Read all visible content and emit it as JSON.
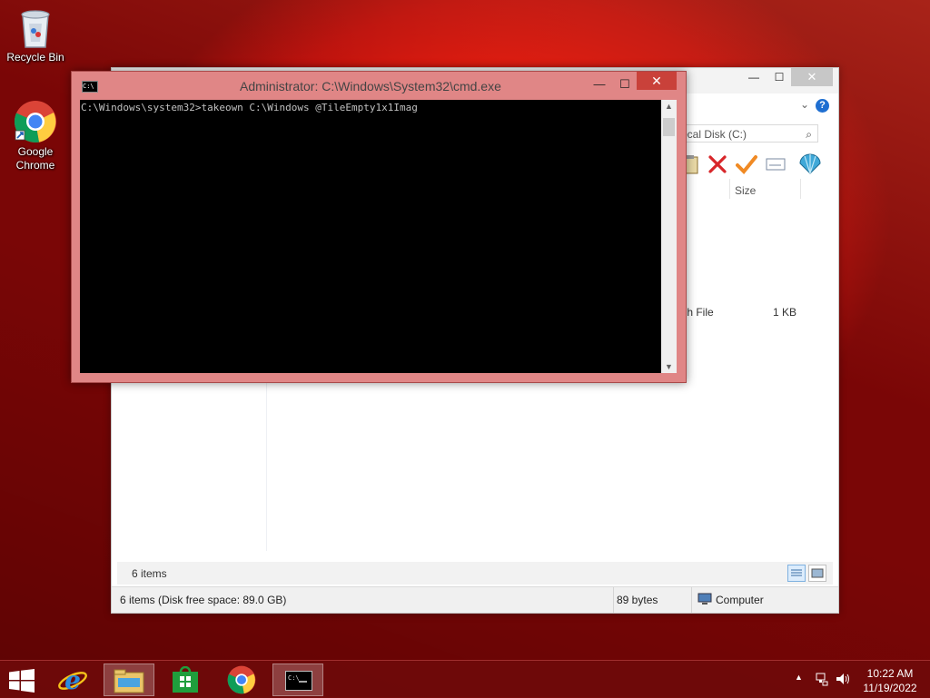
{
  "desktop": {
    "icons": [
      {
        "label": "Recycle Bin",
        "icon": "recycle-bin-icon"
      },
      {
        "label": "Google Chrome",
        "icon": "chrome-icon"
      }
    ]
  },
  "explorer": {
    "search_placeholder": "ocal Disk (C:)",
    "column_size": "Size",
    "rows": [
      {
        "type": "tch File",
        "size": "1 KB"
      }
    ],
    "bottom_count": "6 items",
    "status": {
      "items_free": "6 items (Disk free space: 89.0 GB)",
      "size": "89 bytes",
      "location": "Computer"
    }
  },
  "cmd": {
    "title": "Administrator: C:\\Windows\\System32\\cmd.exe",
    "console_line": "C:\\Windows\\system32>takeown C:\\Windows @TileEmpty1x1Imag",
    "icon_text": "C:\\",
    "close_glyph": "✕",
    "min_glyph": "—",
    "max_glyph": "☐"
  },
  "taskbar": {
    "items": [
      "start",
      "internet-explorer",
      "file-explorer",
      "store",
      "chrome",
      "command-prompt"
    ],
    "clock_time": "10:22 AM",
    "clock_date": "11/19/2022"
  },
  "colors": {
    "wallpaper": "#d4120a",
    "cmd_frame": "#e08686",
    "cmd_close": "#c9413a",
    "taskbar": "#6e0a0a"
  }
}
